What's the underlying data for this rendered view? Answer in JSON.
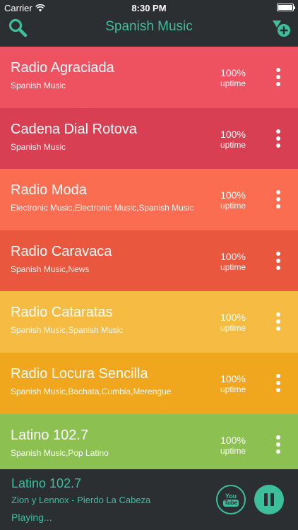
{
  "status_bar": {
    "carrier": "Carrier",
    "time": "8:30 PM"
  },
  "nav": {
    "title": "Spanish Music",
    "left_icon": "search-icon",
    "right_icon": "add-station-icon"
  },
  "stations": [
    {
      "name": "Radio Agraciada",
      "tags": "Spanish Music",
      "uptime": "100%",
      "uptime_label": "uptime",
      "color": "#ee5261"
    },
    {
      "name": "Cadena Dial Rotova",
      "tags": "Spanish Music",
      "uptime": "100%",
      "uptime_label": "uptime",
      "color": "#d93f52"
    },
    {
      "name": "Radio Moda",
      "tags": "Electronic Music,Electronic Music,Spanish Music",
      "uptime": "100%",
      "uptime_label": "uptime",
      "color": "#fb6d50"
    },
    {
      "name": "Radio Caravaca",
      "tags": "Spanish Music,News",
      "uptime": "100%",
      "uptime_label": "uptime",
      "color": "#e9573f"
    },
    {
      "name": "Radio Cataratas",
      "tags": "Spanish Music,Spanish Music",
      "uptime": "100%",
      "uptime_label": "uptime",
      "color": "#f6bb42"
    },
    {
      "name": "Radio Locura Sencilla",
      "tags": "Spanish Music,Bachata,Cumbia,Merengue",
      "uptime": "100%",
      "uptime_label": "uptime",
      "color": "#f0a71e"
    },
    {
      "name": "Latino 102.7",
      "tags": "Spanish Music,Pop Latino",
      "uptime": "100%",
      "uptime_label": "uptime",
      "color": "#8cc152"
    }
  ],
  "player": {
    "station": "Latino 102.7",
    "track": "Zion y Lennox - Pierdo La Cabeza",
    "state": "Playing...",
    "youtube_you": "You",
    "youtube_tube": "Tube",
    "accent_color": "#3dbf9b"
  }
}
